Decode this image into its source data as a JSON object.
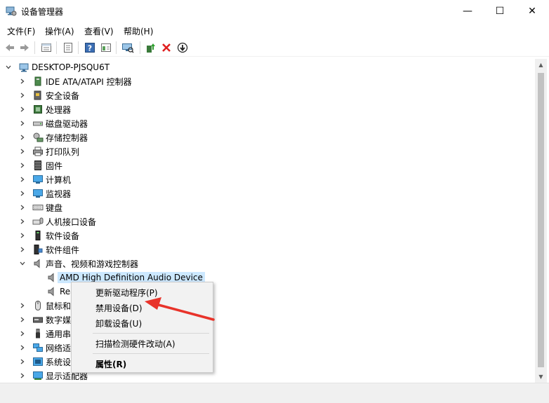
{
  "window": {
    "title": "设备管理器",
    "minimize_glyph": "—",
    "maximize_glyph": "☐",
    "close_glyph": "✕"
  },
  "menu": {
    "items": [
      "文件(F)",
      "操作(A)",
      "查看(V)",
      "帮助(H)"
    ]
  },
  "toolbar": {
    "icons": [
      "back-icon",
      "forward-icon",
      "properties-view-icon",
      "show-hidden-icon",
      "help-icon",
      "console-tree-icon",
      "scan-hardware-icon",
      "update-driver-icon",
      "uninstall-icon",
      "disable-icon"
    ]
  },
  "tree": {
    "root": "DESKTOP-PJSQU6T",
    "categories": [
      "IDE ATA/ATAPI 控制器",
      "安全设备",
      "处理器",
      "磁盘驱动器",
      "存储控制器",
      "打印队列",
      "固件",
      "计算机",
      "监视器",
      "键盘",
      "人机接口设备",
      "软件设备",
      "软件组件",
      "声音、视频和游戏控制器"
    ],
    "audio_children": [
      "AMD High Definition Audio Device",
      "Rea"
    ],
    "after_categories": [
      "鼠标和",
      "数字媒",
      "通用串",
      "网络适",
      "系统设",
      "显示适配器"
    ]
  },
  "context_menu": {
    "items": [
      {
        "label": "更新驱动程序(P)",
        "bold": false
      },
      {
        "label": "禁用设备(D)",
        "bold": false
      },
      {
        "label": "卸载设备(U)",
        "bold": false
      },
      {
        "label": "扫描检测硬件改动(A)",
        "bold": false
      },
      {
        "label": "属性(R)",
        "bold": true
      }
    ]
  },
  "colors": {
    "selection": "#cce8ff",
    "annotation_arrow": "#e8332a",
    "menu_bg": "#f2f2f2"
  }
}
